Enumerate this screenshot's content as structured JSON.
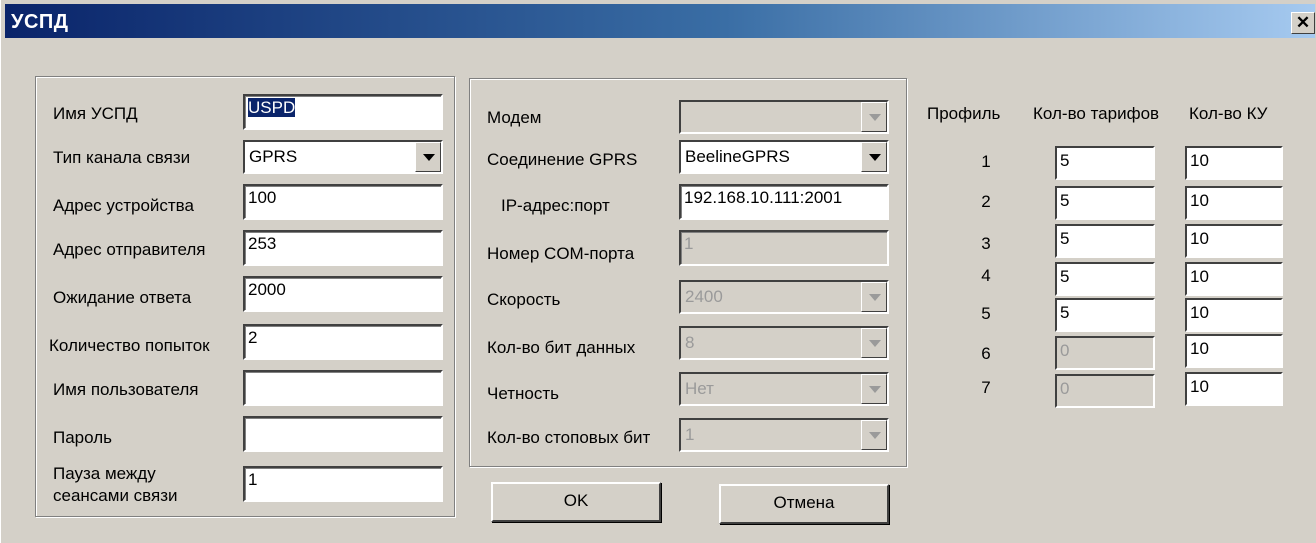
{
  "window": {
    "title": "УСПД",
    "close_glyph": "✕"
  },
  "left": {
    "name_label": "Имя УСПД",
    "name_value": "USPD",
    "channel_label": "Тип канала связи",
    "channel_value": "GPRS",
    "device_addr_label": "Адрес устройства",
    "device_addr_value": "100",
    "sender_addr_label": "Адрес отправителя",
    "sender_addr_value": "253",
    "wait_label": "Ожидание ответа",
    "wait_value": "2000",
    "attempts_label": "Количество попыток",
    "attempts_value": "2",
    "user_label": "Имя пользователя",
    "user_value": "",
    "password_label": "Пароль",
    "password_value": "",
    "pause_label_1": "Пауза между",
    "pause_label_2": "сеансами связи",
    "pause_value": "1"
  },
  "middle": {
    "modem_label": "Модем",
    "modem_value": "",
    "gprs_label": "Соединение GPRS",
    "gprs_value": "BeelineGPRS",
    "ip_label": "IP-адрес:порт",
    "ip_value": "192.168.10.111:2001",
    "com_label": "Номер COM-порта",
    "com_value": "1",
    "speed_label": "Скорость",
    "speed_value": "2400",
    "databits_label": "Кол-во бит данных",
    "databits_value": "8",
    "parity_label": "Четность",
    "parity_value": "Нет",
    "stopbits_label": "Кол-во стоповых бит",
    "stopbits_value": "1"
  },
  "buttons": {
    "ok": "OK",
    "cancel": "Отмена"
  },
  "profiles": {
    "headers": {
      "profile": "Профиль",
      "tariffs": "Кол-во тарифов",
      "ku": "Кол-во КУ"
    },
    "rows": [
      {
        "num": "1",
        "tariffs": "5",
        "ku": "10",
        "tariffs_enabled": true
      },
      {
        "num": "2",
        "tariffs": "5",
        "ku": "10",
        "tariffs_enabled": true
      },
      {
        "num": "3",
        "tariffs": "5",
        "ku": "10",
        "tariffs_enabled": true
      },
      {
        "num": "4",
        "tariffs": "5",
        "ku": "10",
        "tariffs_enabled": true
      },
      {
        "num": "5",
        "tariffs": "5",
        "ku": "10",
        "tariffs_enabled": true
      },
      {
        "num": "6",
        "tariffs": "0",
        "ku": "10",
        "tariffs_enabled": false
      },
      {
        "num": "7",
        "tariffs": "0",
        "ku": "10",
        "tariffs_enabled": false
      }
    ]
  }
}
